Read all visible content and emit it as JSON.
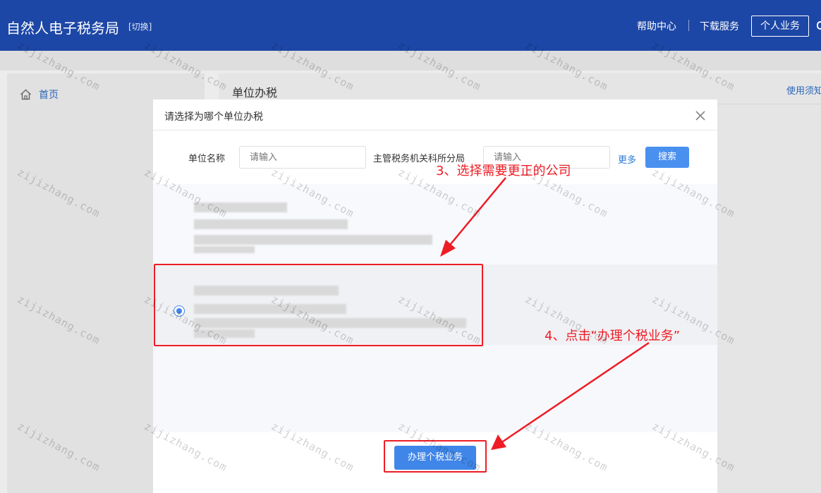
{
  "header": {
    "app_title": "自然人电子税务局",
    "switch_label": "[切换]",
    "help_link": "帮助中心",
    "download_link": "下载服务",
    "personal_button": "个人业务",
    "brand_color": "#1d47a6"
  },
  "sidebar": {
    "items": [
      {
        "label": "首页",
        "icon": "home-icon"
      }
    ]
  },
  "main": {
    "title": "单位办税",
    "usage_link": "使用须知"
  },
  "dialog": {
    "title": "请选择为哪个单位办税",
    "close_icon": "close-icon",
    "filters": {
      "unit_name_label": "单位名称",
      "unit_name_placeholder": "请输入",
      "tax_office_label": "主管税务机关科所分局",
      "tax_office_placeholder": "请输入",
      "more_label": "更多",
      "search_button": "搜索"
    },
    "companies": [
      {
        "selected": false,
        "details_redacted": true
      },
      {
        "selected": true,
        "details_redacted": true
      }
    ],
    "handle_button": "办理个税业务",
    "accent_color": "#3f86e8"
  },
  "annotations": {
    "step3": "3、选择需要更正的公司",
    "step4": "4、点击“办理个税业务”",
    "color": "#ee1c25"
  },
  "watermark": {
    "text": "zijizhang.com"
  }
}
